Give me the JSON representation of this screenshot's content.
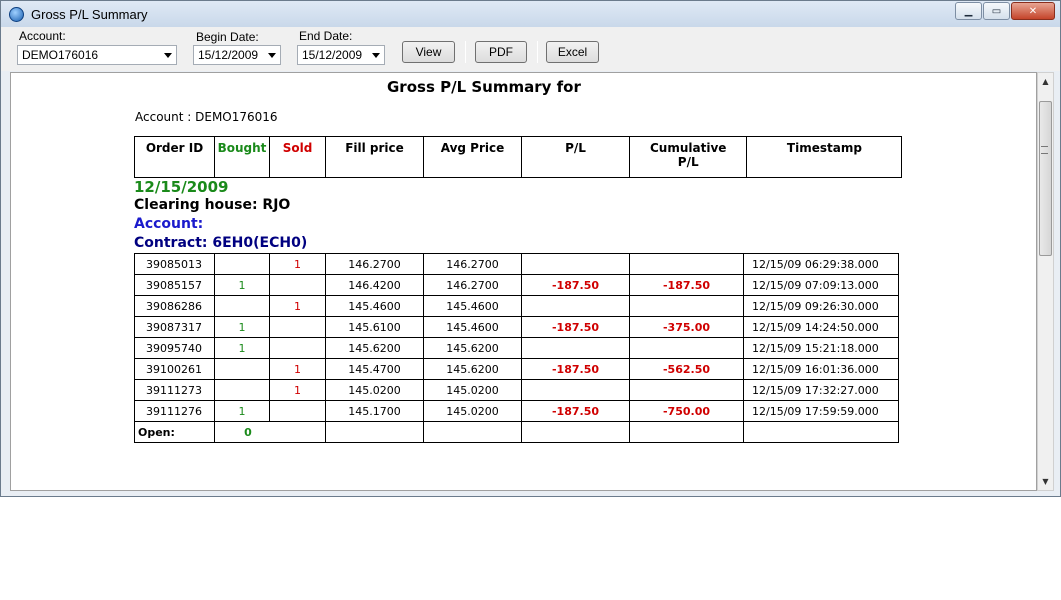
{
  "window": {
    "title": "Gross P/L Summary"
  },
  "toolbar": {
    "account_label": "Account:",
    "account_value": "DEMO176016",
    "begin_label": "Begin Date:",
    "begin_value": "15/12/2009",
    "end_label": "End Date:",
    "end_value": "15/12/2009",
    "view_label": "View",
    "pdf_label": "PDF",
    "excel_label": "Excel"
  },
  "report": {
    "title": "Gross P/L Summary for",
    "account_line": "Account : DEMO176016",
    "columns": [
      "Order ID",
      "Bought",
      "Sold",
      "Fill price",
      "Avg Price",
      "P/L",
      "Cumulative P/L",
      "Timestamp"
    ],
    "group": {
      "date": "12/15/2009",
      "clearing_house": "Clearing house: RJO",
      "account": "Account:",
      "contract": "Contract: 6EH0(ECH0)"
    },
    "rows": [
      {
        "order_id": "39085013",
        "bought": "",
        "sold": "1",
        "fill": "146.2700",
        "avg": "146.2700",
        "pl": "",
        "cum": "",
        "ts": "12/15/09 06:29:38.000"
      },
      {
        "order_id": "39085157",
        "bought": "1",
        "sold": "",
        "fill": "146.4200",
        "avg": "146.2700",
        "pl": "-187.50",
        "cum": "-187.50",
        "ts": "12/15/09 07:09:13.000"
      },
      {
        "order_id": "39086286",
        "bought": "",
        "sold": "1",
        "fill": "145.4600",
        "avg": "145.4600",
        "pl": "",
        "cum": "",
        "ts": "12/15/09 09:26:30.000"
      },
      {
        "order_id": "39087317",
        "bought": "1",
        "sold": "",
        "fill": "145.6100",
        "avg": "145.4600",
        "pl": "-187.50",
        "cum": "-375.00",
        "ts": "12/15/09 14:24:50.000"
      },
      {
        "order_id": "39095740",
        "bought": "1",
        "sold": "",
        "fill": "145.6200",
        "avg": "145.6200",
        "pl": "",
        "cum": "",
        "ts": "12/15/09 15:21:18.000"
      },
      {
        "order_id": "39100261",
        "bought": "",
        "sold": "1",
        "fill": "145.4700",
        "avg": "145.6200",
        "pl": "-187.50",
        "cum": "-562.50",
        "ts": "12/15/09 16:01:36.000"
      },
      {
        "order_id": "39111273",
        "bought": "",
        "sold": "1",
        "fill": "145.0200",
        "avg": "145.0200",
        "pl": "",
        "cum": "",
        "ts": "12/15/09 17:32:27.000"
      },
      {
        "order_id": "39111276",
        "bought": "1",
        "sold": "",
        "fill": "145.1700",
        "avg": "145.0200",
        "pl": "-187.50",
        "cum": "-750.00",
        "ts": "12/15/09 17:59:59.000"
      }
    ],
    "open_label": "Open:",
    "open_value": "0"
  },
  "colors": {
    "bought": "#1a8a1a",
    "sold": "#d00000",
    "account_blue": "#1a1acc",
    "contract_navy": "#000080"
  }
}
